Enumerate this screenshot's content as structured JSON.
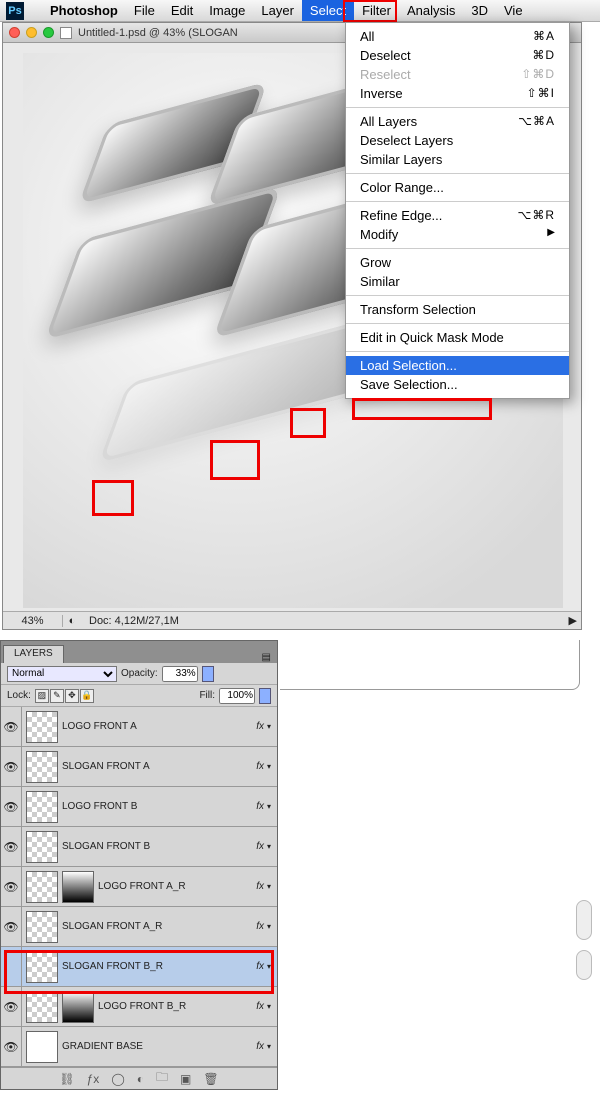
{
  "menubar": {
    "app": "Photoshop",
    "items": [
      "File",
      "Edit",
      "Image",
      "Layer",
      "Select",
      "Filter",
      "Analysis",
      "3D",
      "Vie"
    ]
  },
  "window": {
    "title": "Untitled-1.psd @ 43% (SLOGAN",
    "zoom": "43%",
    "docsize": "Doc: 4,12M/27,1M"
  },
  "select_menu": {
    "items": [
      {
        "label": "All",
        "sc": "⌘A"
      },
      {
        "label": "Deselect",
        "sc": "⌘D"
      },
      {
        "label": "Reselect",
        "sc": "⇧⌘D",
        "disabled": true
      },
      {
        "label": "Inverse",
        "sc": "⇧⌘I"
      },
      {
        "sep": true
      },
      {
        "label": "All Layers",
        "sc": "⌥⌘A"
      },
      {
        "label": "Deselect Layers"
      },
      {
        "label": "Similar Layers"
      },
      {
        "sep": true
      },
      {
        "label": "Color Range..."
      },
      {
        "sep": true
      },
      {
        "label": "Refine Edge...",
        "sc": "⌥⌘R"
      },
      {
        "label": "Modify",
        "sub": true
      },
      {
        "sep": true
      },
      {
        "label": "Grow"
      },
      {
        "label": "Similar"
      },
      {
        "sep": true
      },
      {
        "label": "Transform Selection"
      },
      {
        "sep": true
      },
      {
        "label": "Edit in Quick Mask Mode"
      },
      {
        "sep": true
      },
      {
        "label": "Load Selection...",
        "selected": true
      },
      {
        "label": "Save Selection..."
      }
    ]
  },
  "layers_panel": {
    "tab": "LAYERS",
    "blend_mode": "Normal",
    "opacity_label": "Opacity:",
    "opacity_value": "33%",
    "lock_label": "Lock:",
    "fill_label": "Fill:",
    "fill_value": "100%",
    "layers": [
      {
        "name": "LOGO FRONT A",
        "fx": true,
        "thumb": "chk"
      },
      {
        "name": "SLOGAN FRONT A",
        "fx": true,
        "thumb": "chk"
      },
      {
        "name": "LOGO FRONT B",
        "fx": true,
        "thumb": "chk"
      },
      {
        "name": "SLOGAN FRONT B",
        "fx": true,
        "thumb": "chk"
      },
      {
        "name": "LOGO FRONT A_R",
        "fx": true,
        "thumb": "chk",
        "mask": true
      },
      {
        "name": "SLOGAN FRONT A_R",
        "fx": true,
        "thumb": "chk"
      },
      {
        "name": "SLOGAN FRONT B_R",
        "fx": true,
        "thumb": "chk",
        "selected": true,
        "hidden": true
      },
      {
        "name": "LOGO FRONT B_R",
        "fx": true,
        "thumb": "chk",
        "mask": true
      },
      {
        "name": "GRADIENT BASE",
        "fx": true,
        "thumb": "white"
      }
    ]
  }
}
